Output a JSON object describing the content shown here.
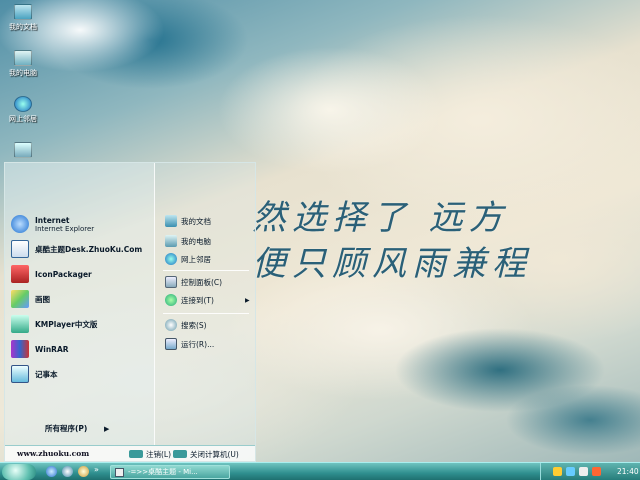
{
  "desktop": {
    "icons": [
      {
        "label": "我的文档",
        "icon": "folder-icon"
      },
      {
        "label": "我的电脑",
        "icon": "computer-icon"
      },
      {
        "label": "网上邻居",
        "icon": "network-icon"
      },
      {
        "label": "",
        "icon": "recycle-bin-icon"
      }
    ],
    "calligraphy": [
      "然选择了 远方",
      "便只顾风雨兼程"
    ]
  },
  "start_menu": {
    "programs": [
      {
        "name": "Internet",
        "sub": "Internet Explorer",
        "icon": "ie-icon"
      },
      {
        "name": "桌酷主题Desk.ZhuoKu.Com",
        "sub": "",
        "icon": "theme-icon"
      },
      {
        "name": "IconPackager",
        "sub": "",
        "icon": "iconpackager-icon"
      },
      {
        "name": "画图",
        "sub": "",
        "icon": "paint-icon"
      },
      {
        "name": "KMPlayer中文版",
        "sub": "",
        "icon": "kmplayer-icon"
      },
      {
        "name": "WinRAR",
        "sub": "",
        "icon": "winrar-icon"
      },
      {
        "name": "记事本",
        "sub": "",
        "icon": "notepad-icon"
      }
    ],
    "all_programs": "所有程序(P)",
    "places": [
      {
        "label": "我的文档",
        "icon": "folder-icon"
      },
      {
        "label": "我的电脑",
        "icon": "computer-icon"
      },
      {
        "label": "网上邻居",
        "icon": "network-icon"
      },
      {
        "label": "控制面板(C)",
        "icon": "control-panel-icon"
      },
      {
        "label": "连接到(T)",
        "icon": "connect-icon"
      },
      {
        "label": "搜索(S)",
        "icon": "search-icon"
      },
      {
        "label": "运行(R)...",
        "icon": "run-icon"
      }
    ],
    "site": "www.zhuoku.com",
    "logoff": "注销(L)",
    "shutdown": "关闭计算机(U)"
  },
  "taskbar": {
    "task_label": "-=>>桌酷主题 - Mi...",
    "clock": "21:40"
  },
  "colors": {
    "accent": "#2f8f8f",
    "calligraphy": "#2a6078"
  }
}
